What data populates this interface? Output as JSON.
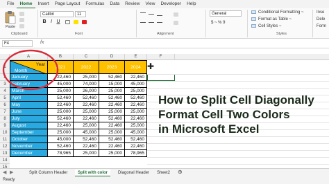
{
  "ribbon_tabs": [
    "File",
    "Home",
    "Insert",
    "Page Layout",
    "Formulas",
    "Data",
    "Review",
    "View",
    "Developer",
    "Help"
  ],
  "active_tab": "Home",
  "clipboard": {
    "paste_label": "Paste",
    "group_label": "Clipboard"
  },
  "font": {
    "name": "Calibri",
    "size": "11",
    "group_label": "Font",
    "bold": "B",
    "italic": "I",
    "underline": "U"
  },
  "alignment": {
    "group_label": "Alignment"
  },
  "number": {
    "format": "General",
    "symbols": "$ ~ % 9"
  },
  "styles": {
    "conditional": "Conditional Formatting ~",
    "table": "Format as Table ~",
    "cell": "Cell Styles ~",
    "group_label": "Styles"
  },
  "cells": {
    "insert": "Inse",
    "delete": "Dele",
    "format": "Form"
  },
  "formula_bar": {
    "name_box": "F4",
    "fx": "fx"
  },
  "columns": [
    "A",
    "B",
    "C",
    "D",
    "E",
    "F"
  ],
  "table": {
    "header_year": "Year",
    "header_month": "Month",
    "years": [
      "2021",
      "2022",
      "2023",
      "2024"
    ],
    "rows": [
      {
        "month": "January",
        "values": [
          "22,460",
          "25,000",
          "52,460",
          "22,460"
        ]
      },
      {
        "month": "February",
        "values": [
          "45,000",
          "74,000",
          "15,000",
          "45,000"
        ]
      },
      {
        "month": "March",
        "values": [
          "25,000",
          "26,000",
          "25,000",
          "25,000"
        ]
      },
      {
        "month": "April",
        "values": [
          "52,460",
          "52,460",
          "52,460",
          "52,460"
        ]
      },
      {
        "month": "May",
        "values": [
          "22,460",
          "22,460",
          "22,460",
          "22,460"
        ]
      },
      {
        "month": "June",
        "values": [
          "25,000",
          "25,000",
          "25,000",
          "25,000"
        ]
      },
      {
        "month": "July",
        "values": [
          "52,460",
          "22,460",
          "52,460",
          "22,460"
        ]
      },
      {
        "month": "August",
        "values": [
          "22,460",
          "25,000",
          "22,460",
          "25,000"
        ]
      },
      {
        "month": "September",
        "values": [
          "25,000",
          "45,000",
          "25,000",
          "45,000"
        ]
      },
      {
        "month": "October",
        "values": [
          "45,000",
          "52,460",
          "52,460",
          "52,460"
        ]
      },
      {
        "month": "November",
        "values": [
          "52,460",
          "22,460",
          "22,460",
          "22,460"
        ]
      },
      {
        "month": "December",
        "values": [
          "78,965",
          "25,000",
          "25,000",
          "78,965"
        ]
      }
    ]
  },
  "row_numbers": [
    "1",
    "2",
    "3",
    "4",
    "5",
    "6",
    "7",
    "8",
    "9",
    "10",
    "11",
    "12",
    "13",
    "14",
    "15",
    "16"
  ],
  "headline": [
    "How to Split Cell Diagonally",
    "Format Cell Two Colors",
    "in Microsoft Excel"
  ],
  "sheet_tabs": [
    "Split Column Header",
    "Split with color",
    "Diagonal Header",
    "Sheet2"
  ],
  "active_sheet": "Split with color",
  "status": "Ready",
  "colors": {
    "month_fill": "#29a9df",
    "year_fill": "#ffc000",
    "accent": "#1e6b34",
    "circle": "#d62c3a"
  }
}
